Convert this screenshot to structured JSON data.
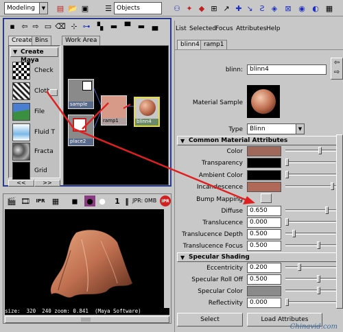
{
  "toolbar": {
    "mode_value": "Modeling",
    "objects_value": "Objects",
    "colors": {
      "accent_red": "#e02020",
      "accent_blue": "#2030c0"
    }
  },
  "hypershade": {
    "tabs": [
      "Create",
      "Bins",
      "Work Area"
    ],
    "create_header": "Create Maya",
    "library": [
      "Check",
      "Cloth",
      "File",
      "Fluid T",
      "Fracta",
      "Grid"
    ],
    "nodes": [
      {
        "label": "sample",
        "value": "sample"
      },
      {
        "label": "place2d",
        "value": "place2"
      },
      {
        "label": "ramp1",
        "value": "ramp1"
      },
      {
        "label": "blinn4",
        "value": "blinn4"
      }
    ],
    "scroll_labels": [
      "<<",
      ">>"
    ]
  },
  "render": {
    "jpr_label": "JPR: 0MB",
    "ipr_label": "IPR",
    "pause_label": "1",
    "status_text": "size:  320  240 zoom: 0.841  (Maya Software)"
  },
  "attr_editor": {
    "menu": [
      "List",
      "Selected",
      "Focus",
      "Attributes",
      "Help"
    ],
    "tabs": [
      "blinn4",
      "ramp1"
    ],
    "blinn_label": "blinn:",
    "blinn_value": "blinn4",
    "material_sample_label": "Material Sample",
    "type_label": "Type",
    "type_value": "Blinn",
    "common_section": "Common Material Attributes",
    "color_rows": [
      {
        "label": "Color",
        "color": "#a0685a"
      },
      {
        "label": "Transparency",
        "color": "#000000"
      },
      {
        "label": "Ambient Color",
        "color": "#000000"
      },
      {
        "label": "Incandescence",
        "color": "#b06858"
      }
    ],
    "bump_label": "Bump Mapping",
    "numeric_rows": [
      {
        "label": "Diffuse",
        "value": "0.650"
      },
      {
        "label": "Translucence",
        "value": "0.000"
      },
      {
        "label": "Translucence Depth",
        "value": "0.500"
      },
      {
        "label": "Translucence Focus",
        "value": "0.500"
      }
    ],
    "specular_section": "Specular Shading",
    "specular_rows": [
      {
        "label": "Eccentricity",
        "value": "0.200"
      },
      {
        "label": "Specular Roll Off",
        "value": "0.500"
      },
      {
        "label": "Specular Color",
        "color": "#8a8a8a"
      },
      {
        "label": "Reflectivity",
        "value": "0.000"
      }
    ],
    "select_button": "Select",
    "load_button": "Load Attributes"
  },
  "watermark": "Chinavid.com"
}
